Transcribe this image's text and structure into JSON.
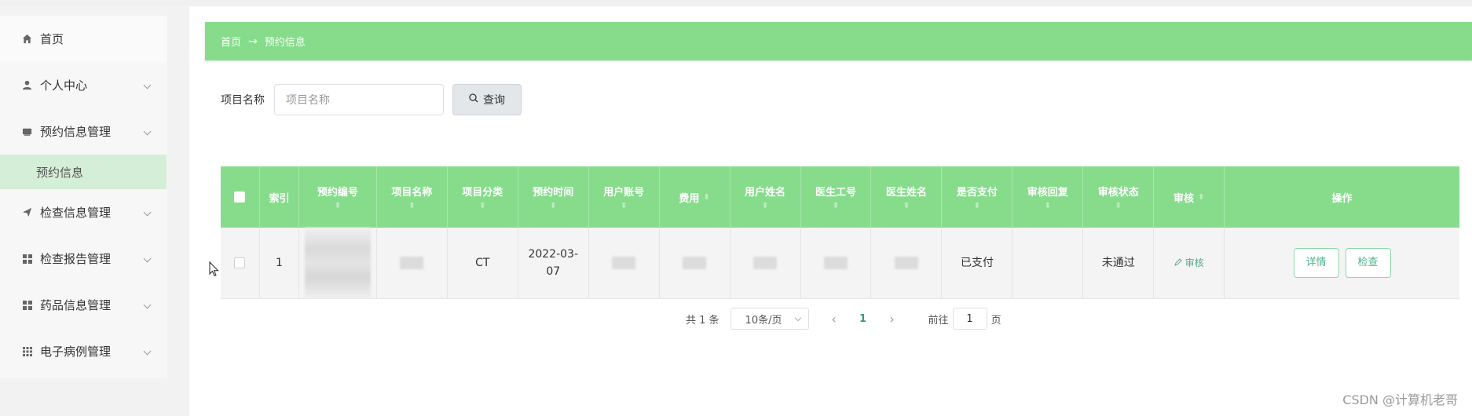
{
  "sidebar": {
    "items": [
      {
        "label": "首页",
        "icon": "home-icon"
      },
      {
        "label": "个人中心",
        "icon": "user-icon"
      },
      {
        "label": "预约信息管理",
        "icon": "folder-icon",
        "submenu": [
          {
            "label": "预约信息",
            "active": true
          }
        ]
      },
      {
        "label": "检查信息管理",
        "icon": "send-icon"
      },
      {
        "label": "检查报告管理",
        "icon": "grid-icon"
      },
      {
        "label": "药品信息管理",
        "icon": "grid-icon"
      },
      {
        "label": "电子病例管理",
        "icon": "grid-dots-icon"
      }
    ]
  },
  "breadcrumb": {
    "home": "首页",
    "separator": "→",
    "current": "预约信息"
  },
  "search": {
    "label": "项目名称",
    "placeholder": "项目名称",
    "button_label": "查询"
  },
  "table": {
    "headers": [
      "索引",
      "预约编号",
      "项目名称",
      "项目分类",
      "预约时间",
      "用户账号",
      "费用",
      "用户姓名",
      "医生工号",
      "医生姓名",
      "是否支付",
      "审核回复",
      "审核状态",
      "审核",
      "操作"
    ],
    "rows": [
      {
        "index": "1",
        "category": "CT",
        "time": "2022-03-07",
        "paid": "已支付",
        "reply": "",
        "status": "未通过",
        "audit_label": "审核",
        "detail_label": "详情",
        "check_label": "检查"
      }
    ]
  },
  "pager": {
    "total": "共 1 条",
    "page_size": "10条/页",
    "current_page": "1",
    "goto_label": "前往",
    "goto_value": "1",
    "page_suffix": "页"
  },
  "watermark": "CSDN @计算机老哥",
  "colors": {
    "accent": "#86dc8b",
    "submenu_active": "#d5eed7",
    "link": "#4cb38a"
  }
}
